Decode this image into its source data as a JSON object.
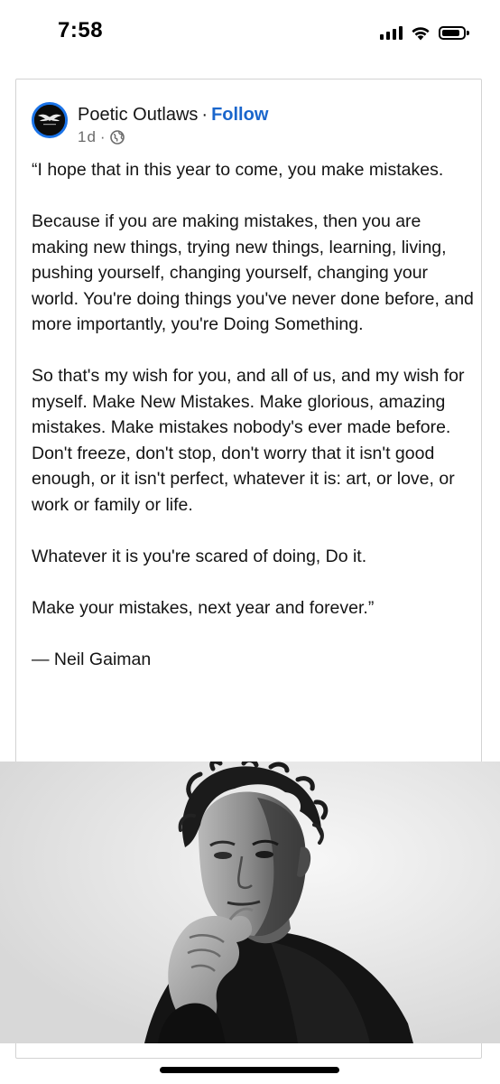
{
  "status_bar": {
    "time": "7:58",
    "icons": [
      "cellular-signal-icon",
      "wifi-icon",
      "battery-icon"
    ]
  },
  "post": {
    "author": "Poetic Outlaws",
    "separator": "·",
    "follow_label": "Follow",
    "age": "1d",
    "meta_separator": "·",
    "visibility_icon": "globe-icon",
    "avatar_icon": "winged-logo-icon",
    "paragraphs": [
      "“I hope that in this year to come, you make mistakes.",
      "Because if you are making mistakes, then you are making new things, trying new things, learning, living, pushing yourself, changing yourself, changing your world. You're doing things you've never done before, and more importantly, you're Doing Something.",
      "So that's my wish for you, and all of us, and my wish for myself. Make New Mistakes. Make glorious, amazing mistakes. Make mistakes nobody's ever made before. Don't freeze, don't stop, don't worry that it isn't good enough, or it isn't perfect, whatever it is: art, or love, or work or family or life.",
      "Whatever it is you're scared of doing, Do it.",
      "Make your mistakes, next year and forever.”",
      "— Neil Gaiman"
    ],
    "image": "black-and-white portrait photo"
  },
  "colors": {
    "follow": "#1a66cc",
    "avatar_ring": "#1a73e8",
    "meta_text": "#6b6b6b"
  }
}
